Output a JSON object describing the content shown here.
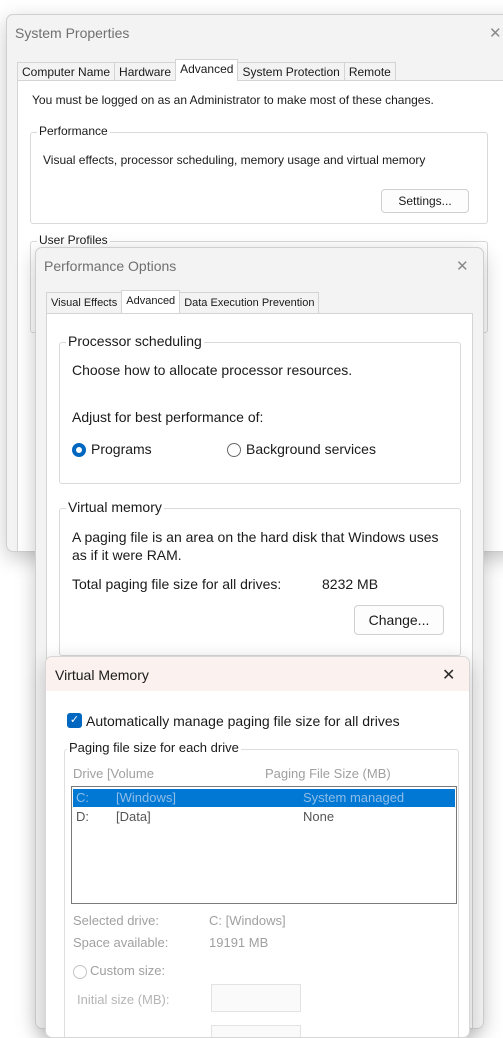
{
  "system_properties": {
    "title": "System Properties",
    "close_glyph": "✕",
    "tabs": [
      "Computer Name",
      "Hardware",
      "Advanced",
      "System Protection",
      "Remote"
    ],
    "admin_notice": "You must be logged on as an Administrator to make most of these changes.",
    "performance": {
      "legend": "Performance",
      "description": "Visual effects, processor scheduling, memory usage and virtual memory",
      "settings_button": "Settings..."
    },
    "user_profiles_legend": "User Profiles"
  },
  "performance_options": {
    "title": "Performance Options",
    "close_glyph": "✕",
    "tabs": [
      "Visual Effects",
      "Advanced",
      "Data Execution Prevention"
    ],
    "processor_scheduling": {
      "legend": "Processor scheduling",
      "description": "Choose how to allocate processor resources.",
      "adjust_label": "Adjust for best performance of:",
      "options": [
        {
          "label": "Programs",
          "selected": true
        },
        {
          "label": "Background services",
          "selected": false
        }
      ]
    },
    "virtual_memory": {
      "legend": "Virtual memory",
      "description_line1": "A paging file is an area on the hard disk that Windows uses",
      "description_line2": "as if it were RAM.",
      "total_label": "Total paging file size for all drives:",
      "total_value": "8232 MB",
      "change_button": "Change..."
    }
  },
  "virtual_memory_dialog": {
    "title": "Virtual Memory",
    "close_glyph": "✕",
    "auto_manage": {
      "label": "Automatically manage paging file size for all drives",
      "checked": true
    },
    "paging_legend": "Paging file size for each drive",
    "columns": {
      "drive": "Drive  [Volume",
      "size": "Paging File Size (MB)"
    },
    "drives": [
      {
        "drive": "C:",
        "volume": "[Windows]",
        "size": "System managed",
        "selected": true
      },
      {
        "drive": "D:",
        "volume": "[Data]",
        "size": "None",
        "selected": false
      }
    ],
    "selected_drive": {
      "label": "Selected drive:",
      "value": "C:  [Windows]"
    },
    "space_available": {
      "label": "Space available:",
      "value": "19191 MB"
    },
    "custom_size": {
      "label": "Custom size:",
      "selected": false
    },
    "initial_size_label": "Initial size (MB):",
    "colors": {
      "accent": "#0067c0",
      "selection": "#0078d4",
      "disabled_text": "#a0a0a0"
    }
  }
}
